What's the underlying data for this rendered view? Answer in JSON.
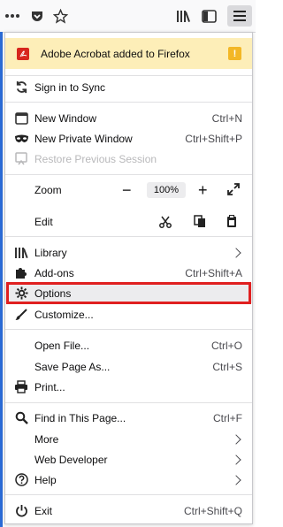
{
  "toolbar": {
    "overflow_icon": "ellipsis-icon",
    "pocket_icon": "pocket-icon",
    "bookmark_icon": "star-icon",
    "library_icon": "library-icon",
    "sidebar_icon": "sidebar-icon",
    "menu_icon": "hamburger-menu-icon"
  },
  "notification": {
    "label": "Adobe Acrobat added to Firefox",
    "badge": "!"
  },
  "menu": {
    "sync": "Sign in to Sync",
    "new_window": {
      "label": "New Window",
      "shortcut": "Ctrl+N"
    },
    "new_private_window": {
      "label": "New Private Window",
      "shortcut": "Ctrl+Shift+P"
    },
    "restore_session": {
      "label": "Restore Previous Session"
    },
    "zoom": {
      "label": "Zoom",
      "minus": "−",
      "value": "100%",
      "plus": "+"
    },
    "edit": {
      "label": "Edit"
    },
    "library": {
      "label": "Library"
    },
    "addons": {
      "label": "Add-ons",
      "shortcut": "Ctrl+Shift+A"
    },
    "options": {
      "label": "Options"
    },
    "customize": {
      "label": "Customize..."
    },
    "open_file": {
      "label": "Open File...",
      "shortcut": "Ctrl+O"
    },
    "save_page": {
      "label": "Save Page As...",
      "shortcut": "Ctrl+S"
    },
    "print": {
      "label": "Print..."
    },
    "find": {
      "label": "Find in This Page...",
      "shortcut": "Ctrl+F"
    },
    "more": {
      "label": "More"
    },
    "web_developer": {
      "label": "Web Developer"
    },
    "help": {
      "label": "Help"
    },
    "exit": {
      "label": "Exit",
      "shortcut": "Ctrl+Shift+Q"
    }
  },
  "colors": {
    "highlight_border": "#e02020",
    "notification_bg": "#fdeeb8",
    "warning_badge": "#f3b726",
    "pdf_icon": "#d7261d"
  }
}
